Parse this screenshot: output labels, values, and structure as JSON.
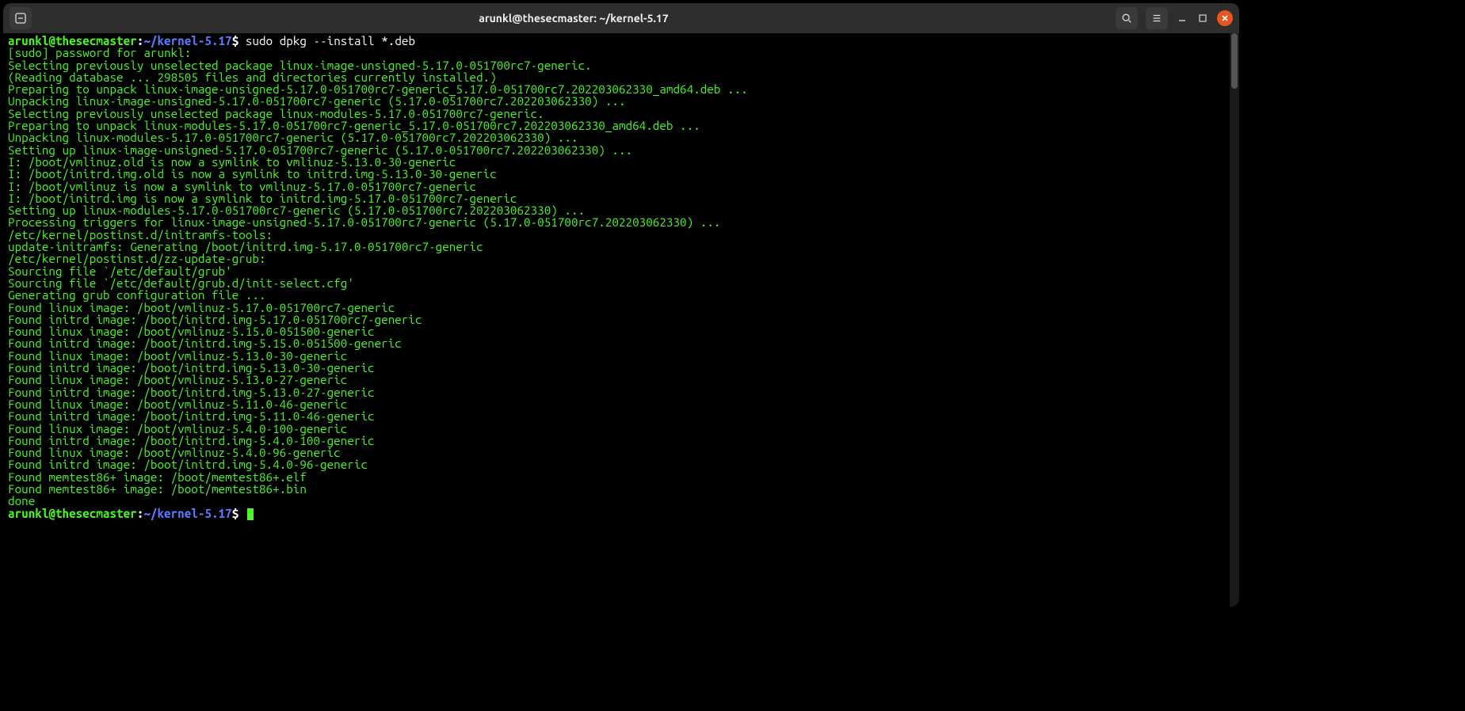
{
  "titlebar": {
    "title": "arunkl@thesecmaster: ~/kernel-5.17"
  },
  "prompt": {
    "user": "arunkl@thesecmaster",
    "colon": ":",
    "path": "~/kernel-5.17",
    "dollar": "$"
  },
  "command": " sudo dpkg --install *.deb",
  "output_lines": [
    "[sudo] password for arunkl:",
    "Selecting previously unselected package linux-image-unsigned-5.17.0-051700rc7-generic.",
    "(Reading database ... 298505 files and directories currently installed.)",
    "Preparing to unpack linux-image-unsigned-5.17.0-051700rc7-generic_5.17.0-051700rc7.202203062330_amd64.deb ...",
    "Unpacking linux-image-unsigned-5.17.0-051700rc7-generic (5.17.0-051700rc7.202203062330) ...",
    "Selecting previously unselected package linux-modules-5.17.0-051700rc7-generic.",
    "Preparing to unpack linux-modules-5.17.0-051700rc7-generic_5.17.0-051700rc7.202203062330_amd64.deb ...",
    "Unpacking linux-modules-5.17.0-051700rc7-generic (5.17.0-051700rc7.202203062330) ...",
    "Setting up linux-image-unsigned-5.17.0-051700rc7-generic (5.17.0-051700rc7.202203062330) ...",
    "I: /boot/vmlinuz.old is now a symlink to vmlinuz-5.13.0-30-generic",
    "I: /boot/initrd.img.old is now a symlink to initrd.img-5.13.0-30-generic",
    "I: /boot/vmlinuz is now a symlink to vmlinuz-5.17.0-051700rc7-generic",
    "I: /boot/initrd.img is now a symlink to initrd.img-5.17.0-051700rc7-generic",
    "Setting up linux-modules-5.17.0-051700rc7-generic (5.17.0-051700rc7.202203062330) ...",
    "Processing triggers for linux-image-unsigned-5.17.0-051700rc7-generic (5.17.0-051700rc7.202203062330) ...",
    "/etc/kernel/postinst.d/initramfs-tools:",
    "update-initramfs: Generating /boot/initrd.img-5.17.0-051700rc7-generic",
    "/etc/kernel/postinst.d/zz-update-grub:",
    "Sourcing file `/etc/default/grub'",
    "Sourcing file `/etc/default/grub.d/init-select.cfg'",
    "Generating grub configuration file ...",
    "Found linux image: /boot/vmlinuz-5.17.0-051700rc7-generic",
    "Found initrd image: /boot/initrd.img-5.17.0-051700rc7-generic",
    "Found linux image: /boot/vmlinuz-5.15.0-051500-generic",
    "Found initrd image: /boot/initrd.img-5.15.0-051500-generic",
    "Found linux image: /boot/vmlinuz-5.13.0-30-generic",
    "Found initrd image: /boot/initrd.img-5.13.0-30-generic",
    "Found linux image: /boot/vmlinuz-5.13.0-27-generic",
    "Found initrd image: /boot/initrd.img-5.13.0-27-generic",
    "Found linux image: /boot/vmlinuz-5.11.0-46-generic",
    "Found initrd image: /boot/initrd.img-5.11.0-46-generic",
    "Found linux image: /boot/vmlinuz-5.4.0-100-generic",
    "Found initrd image: /boot/initrd.img-5.4.0-100-generic",
    "Found linux image: /boot/vmlinuz-5.4.0-96-generic",
    "Found initrd image: /boot/initrd.img-5.4.0-96-generic",
    "Found memtest86+ image: /boot/memtest86+.elf",
    "Found memtest86+ image: /boot/memtest86+.bin",
    "done"
  ]
}
